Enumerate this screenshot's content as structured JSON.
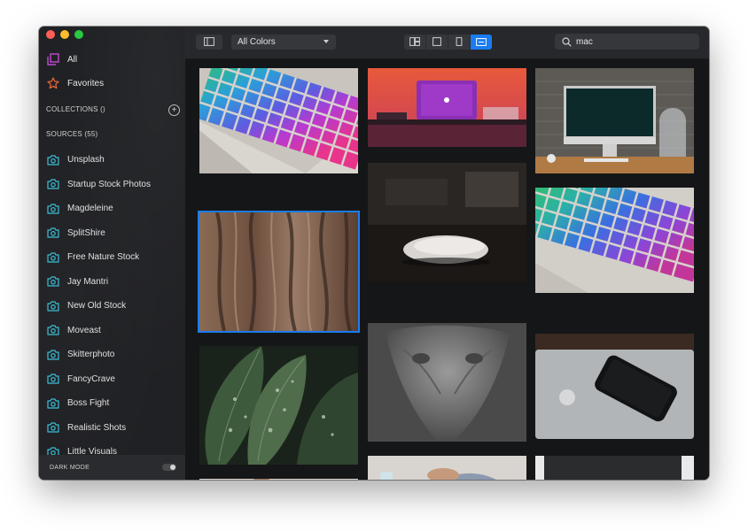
{
  "sidebar": {
    "all_label": "All",
    "favorites_label": "Favorites",
    "collections_title": "COLLECTIONS ()",
    "sources_title": "SOURCES (55)",
    "sources": [
      "Unsplash",
      "Startup Stock Photos",
      "Magdeleine",
      "SplitShire",
      "Free Nature Stock",
      "Jay Mantri",
      "New Old Stock",
      "Moveast",
      "Skitterphoto",
      "FancyCrave",
      "Boss Fight",
      "Realistic Shots",
      "Little Visuals"
    ],
    "dark_mode_label": "DARK MODE",
    "dark_mode_on": true
  },
  "toolbar": {
    "color_filter": "All Colors",
    "search_value": "mac",
    "view_modes": [
      "mosaic-view",
      "square-view",
      "portrait-view",
      "landscape-view"
    ],
    "active_view": "landscape-view"
  },
  "photos": [
    {
      "name": "rainbow-keyboard-photo"
    },
    {
      "name": "laptop-orange-desk-photo"
    },
    {
      "name": "imac-desk-photo"
    },
    {
      "name": "tree-bark-photo",
      "selected": true
    },
    {
      "name": "magic-mouse-photo"
    },
    {
      "name": "rainbow-keyboard-2-photo"
    },
    {
      "name": "water-leaves-photo"
    },
    {
      "name": "animal-skull-photo"
    },
    {
      "name": "iphone-on-macbook-photo"
    },
    {
      "name": "person-photo"
    },
    {
      "name": "hands-laptop-photo"
    },
    {
      "name": "imac-back-photo"
    }
  ],
  "colors": {
    "accent": "#1a7cf3",
    "all_icon": "#c04bd2",
    "favorites_icon": "#f0683c",
    "source_icon": "#3bbfd6"
  }
}
